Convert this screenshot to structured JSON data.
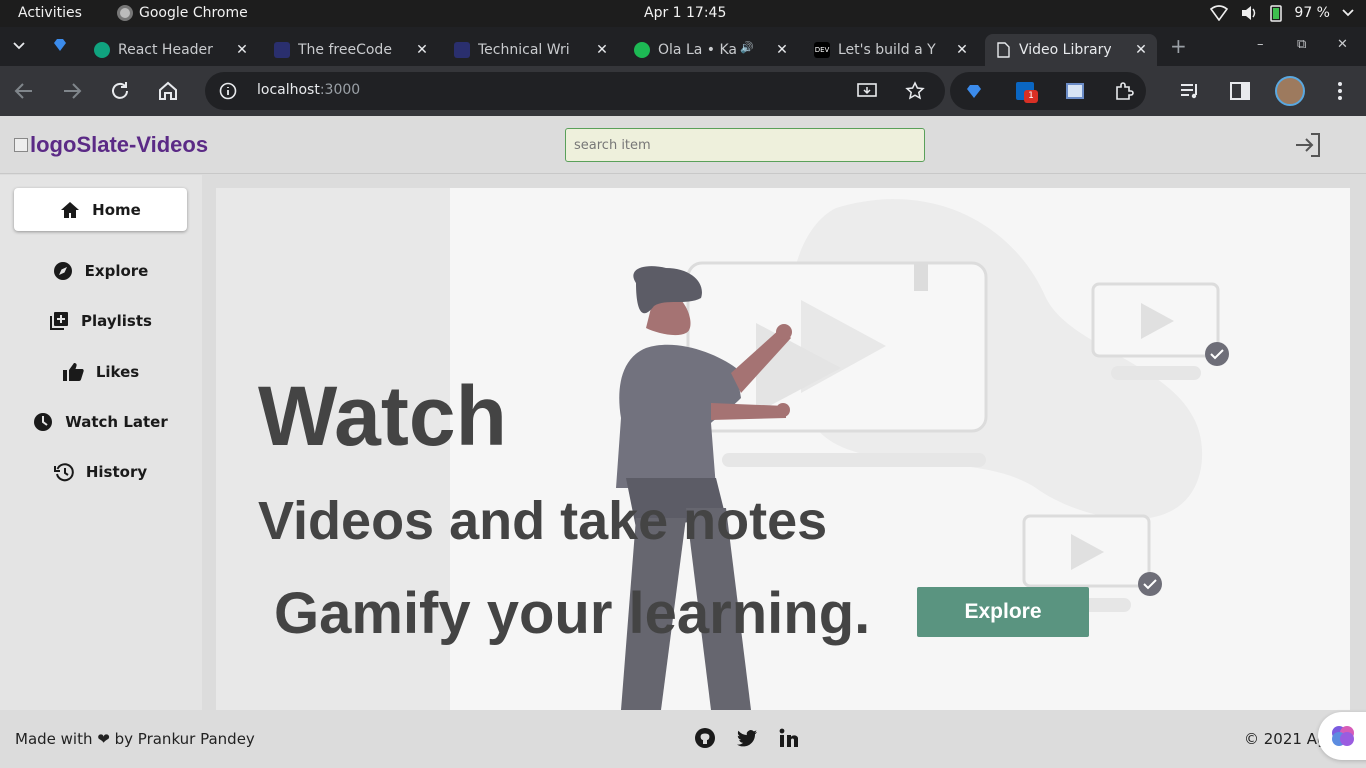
{
  "system": {
    "activities": "Activities",
    "app_name": "Google Chrome",
    "clock": "Apr 1  17:45",
    "battery": "97 %"
  },
  "browser": {
    "tabs": [
      {
        "label": "React Header",
        "icon": "openai-icon",
        "color": "#10a37f"
      },
      {
        "label": "The freeCode",
        "icon": "hashnode-icon",
        "color": "#2a2f6e"
      },
      {
        "label": "Technical Wri",
        "icon": "hashnode-icon",
        "color": "#2a2f6e"
      },
      {
        "label": "Ola La • Ka",
        "icon": "spotify-icon",
        "color": "#1db954"
      },
      {
        "label": "Let's build a Y",
        "icon": "dev-icon",
        "color": "#000000"
      },
      {
        "label": "Video Library",
        "icon": "page-icon",
        "color": "#e8eaed"
      }
    ],
    "url_host": "localhost",
    "url_port": ":3000"
  },
  "app": {
    "logo_alt": "logo",
    "brand": "Slate-Videos",
    "search_placeholder": "search item",
    "nav": [
      {
        "label": "Home",
        "icon": "home-icon"
      },
      {
        "label": "Explore",
        "icon": "compass-icon"
      },
      {
        "label": "Playlists",
        "icon": "playlist-add-icon"
      },
      {
        "label": "Likes",
        "icon": "thumbs-up-icon"
      },
      {
        "label": "Watch Later",
        "icon": "clock-icon"
      },
      {
        "label": "History",
        "icon": "history-icon"
      }
    ],
    "hero": {
      "line1": "Watch",
      "line2": "Videos and take notes",
      "line3": "Gamify your learning.",
      "cta": "Explore"
    },
    "footer": {
      "made_prefix": "Made with",
      "heart": "❤",
      "made_suffix": "by Prankur Pandey",
      "copyright": "© 2021 Ag"
    }
  }
}
